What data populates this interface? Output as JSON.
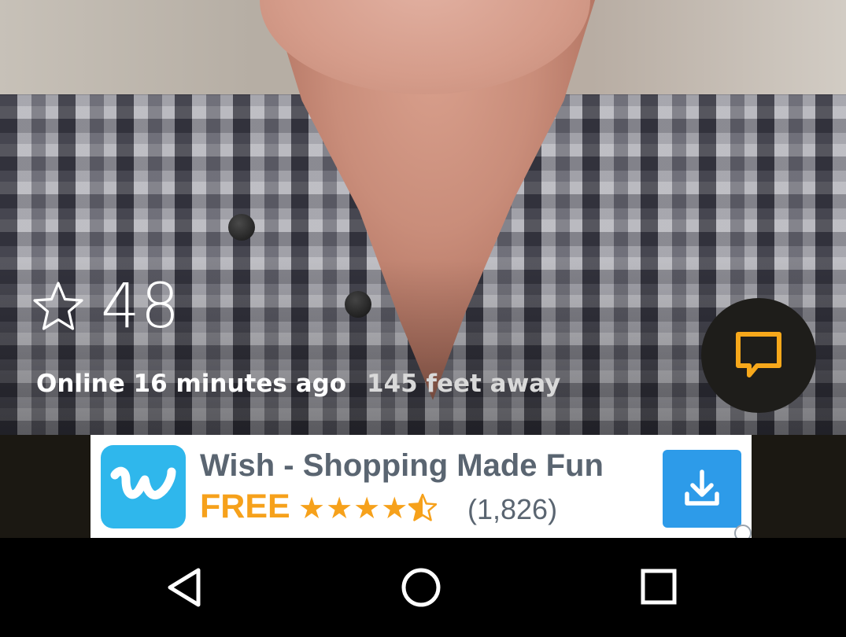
{
  "profile": {
    "rating": "48",
    "online_status": "Online 16 minutes ago",
    "distance": "145 feet away"
  },
  "icons": {
    "favorite": "star-outline-icon",
    "chat": "chat-bubble-icon",
    "download": "download-icon"
  },
  "ad": {
    "title": "Wish - Shopping Made Fun",
    "price": "FREE",
    "stars": "★★★★",
    "rating_value": 4.5,
    "reviews": "(1,826)",
    "logo_letter": "w"
  },
  "nav": {
    "back": "back-icon",
    "home": "home-icon",
    "recents": "recents-icon"
  },
  "colors": {
    "chat_accent": "#f7a81b",
    "ad_orange": "#f6a11b",
    "ad_blue": "#2fb7ec",
    "download_blue": "#2d9be9",
    "ad_text": "#5a6571"
  }
}
